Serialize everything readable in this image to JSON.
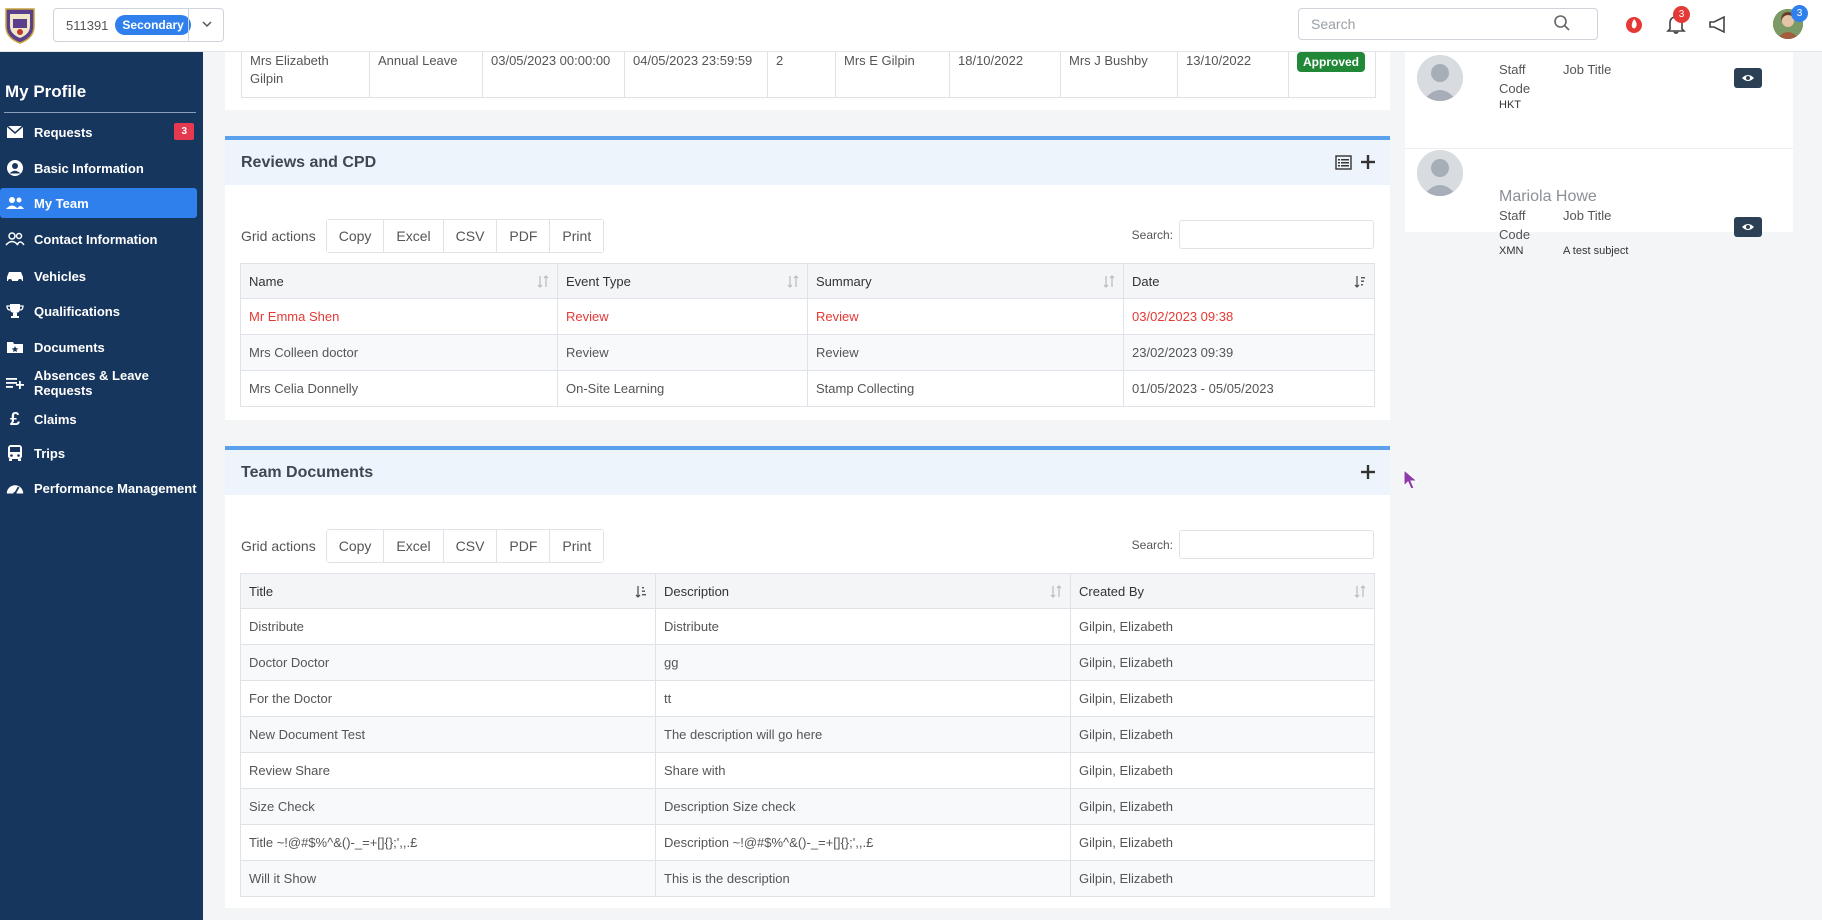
{
  "topbar": {
    "school_id": "511391",
    "school_badge": "Secondary",
    "search_placeholder": "Search",
    "notifications_count": "3",
    "avatar_count": "3"
  },
  "sidebar": {
    "title": "My Profile",
    "requests_badge": "3",
    "items": [
      {
        "label": "Requests",
        "icon": "envelope-icon"
      },
      {
        "label": "Basic Information",
        "icon": "user-circle-icon"
      },
      {
        "label": "My Team",
        "icon": "users-icon"
      },
      {
        "label": "Contact Information",
        "icon": "contacts-icon"
      },
      {
        "label": "Vehicles",
        "icon": "car-icon"
      },
      {
        "label": "Qualifications",
        "icon": "trophy-icon"
      },
      {
        "label": "Documents",
        "icon": "folder-star-icon"
      },
      {
        "label": "Absences & Leave Requests",
        "icon": "list-plus-icon"
      },
      {
        "label": "Claims",
        "icon": "pound-icon"
      },
      {
        "label": "Trips",
        "icon": "bus-icon"
      },
      {
        "label": "Performance Management",
        "icon": "gauge-icon"
      }
    ]
  },
  "leave_row": {
    "name": "Mrs Elizabeth Gilpin",
    "type": "Annual Leave",
    "start": "03/05/2023 00:00:00",
    "end": "04/05/2023 23:59:59",
    "days": "2",
    "requested_by": "Mrs E Gilpin",
    "requested_on": "18/10/2022",
    "approved_by": "Mrs J Bushby",
    "approved_on": "13/10/2022",
    "status": "Approved"
  },
  "reviews": {
    "title": "Reviews and CPD",
    "grid_actions_label": "Grid actions",
    "buttons": [
      "Copy",
      "Excel",
      "CSV",
      "PDF",
      "Print"
    ],
    "search_label": "Search:",
    "columns": [
      "Name",
      "Event Type",
      "Summary",
      "Date"
    ],
    "rows": [
      [
        "Mr Emma Shen",
        "Review",
        "Review",
        "03/02/2023 09:38"
      ],
      [
        "Mrs Colleen doctor",
        "Review",
        "Review",
        "23/02/2023 09:39"
      ],
      [
        "Mrs Celia Donnelly",
        "On-Site Learning",
        "Stamp Collecting",
        "01/05/2023 - 05/05/2023"
      ]
    ],
    "highlight_color": "#e53935"
  },
  "documents": {
    "title": "Team Documents",
    "grid_actions_label": "Grid actions",
    "buttons": [
      "Copy",
      "Excel",
      "CSV",
      "PDF",
      "Print"
    ],
    "search_label": "Search:",
    "columns": [
      "Title",
      "Description",
      "Created By"
    ],
    "rows": [
      [
        "Distribute",
        "Distribute",
        "Gilpin, Elizabeth"
      ],
      [
        "Doctor Doctor",
        "gg",
        "Gilpin, Elizabeth"
      ],
      [
        "For the Doctor",
        "tt",
        "Gilpin, Elizabeth"
      ],
      [
        "New Document Test",
        "The description will go here",
        "Gilpin, Elizabeth"
      ],
      [
        "Review Share",
        "Share with",
        "Gilpin, Elizabeth"
      ],
      [
        "Size Check",
        "Description Size check",
        "Gilpin, Elizabeth"
      ],
      [
        "Title ~!@#$%^&()-_=+[]{};',,.£",
        "Description ~!@#$%^&()-_=+[]{};',,.£",
        "Gilpin, Elizabeth"
      ],
      [
        "Will it Show",
        "This is the description",
        "Gilpin, Elizabeth"
      ]
    ]
  },
  "team_members": [
    {
      "name": "",
      "staff_label": "Staff",
      "code_label": "Code",
      "code": "HKT",
      "job_title_label": "Job Title",
      "job_title": ""
    },
    {
      "name": "Mariola Howe",
      "staff_label": "Staff",
      "code_label": "Code",
      "code": "XMN",
      "job_title_label": "Job Title",
      "job_title": "A test subject"
    }
  ],
  "colors": {
    "sidebar_bg": "#17365d",
    "accent": "#2f80ed",
    "approved": "#218838",
    "panel_header_border": "#5aa0ea"
  }
}
